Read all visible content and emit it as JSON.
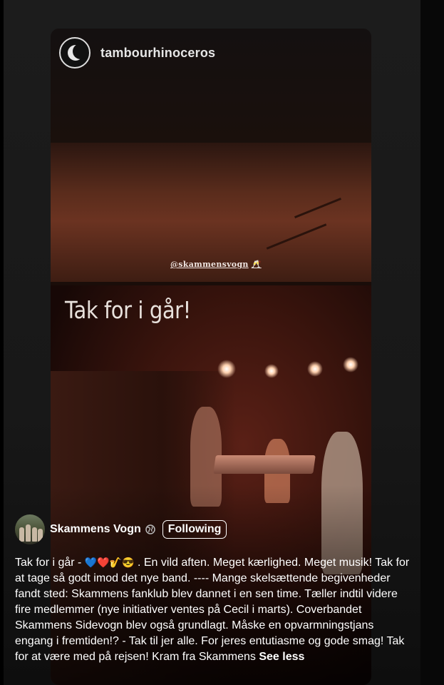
{
  "story": {
    "username": "tambourhinoceros",
    "mention": "@skammensvogn",
    "mention_emoji": "🥂",
    "overlay_text": "Tak for i går!"
  },
  "post": {
    "author": "Skammens Vogn",
    "audience_icon": "globe-icon",
    "follow_label": "Following",
    "caption_lead": "Tak for i går - ",
    "caption_emojis": "💙❤️🎷😎",
    "caption_body": " . En vild aften. Meget kærlighed. Meget musik! Tak for at tage så godt imod det nye band. ---- Mange skelsættende begivenheder fandt sted: Skammens fanklub blev dannet i en sen time. Tæller indtil videre fire medlemmer (nye initiativer ventes på Cecil i marts). Coverbandet Skammens Sidevogn blev også grundlagt. Måske en opvarmningstjans engang i fremtiden!? - Tak til jer alle. For jeres entutiasme og gode smag! Tak for at være med på rejsen! Kram fra Skammens ",
    "see_less_label": "See less"
  }
}
